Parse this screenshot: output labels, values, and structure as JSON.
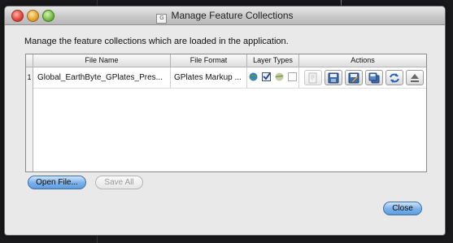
{
  "window": {
    "title": "Manage Feature Collections"
  },
  "description": "Manage the feature collections which are loaded in the application.",
  "table": {
    "columns": [
      "File Name",
      "File Format",
      "Layer Types",
      "Actions"
    ],
    "rows": [
      {
        "index": "1",
        "file_name": "Global_EarthByte_GPlates_Pres...",
        "file_format": "GPlates Markup ..."
      }
    ]
  },
  "layer_type_icons": [
    "globe-icon",
    "checkbox-checked-icon",
    "raster-globe-icon",
    "checkbox-empty-icon"
  ],
  "action_icons": [
    "edit-configuration-icon",
    "save-icon",
    "save-as-icon",
    "save-copy-icon",
    "reload-icon",
    "unload-icon"
  ],
  "buttons": {
    "open_file": "Open File...",
    "save_all": "Save All",
    "close": "Close"
  },
  "colors": {
    "primary_button": "#7fb3ea",
    "window_bg": "#e9e9e9"
  }
}
